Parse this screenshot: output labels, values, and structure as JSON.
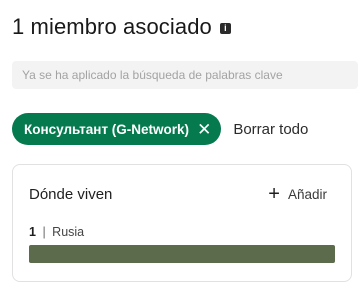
{
  "header": {
    "title": "1 miembro asociado",
    "info_icon": "info-icon"
  },
  "search": {
    "placeholder": "Ya se ha aplicado la búsqueda de palabras clave",
    "value": ""
  },
  "filters": {
    "chips": [
      {
        "label": "Консультант (G-Network)",
        "close_icon": "close-icon",
        "color": "#067a4f"
      }
    ],
    "clear_all_label": "Borrar todo"
  },
  "location_card": {
    "title": "Dónde viven",
    "add_label": "Añadir",
    "add_icon": "plus-icon",
    "rows": [
      {
        "count": "1",
        "separator": "|",
        "name": "Rusia",
        "fraction": 1.0,
        "bar_color": "#5b6b4c"
      }
    ]
  }
}
